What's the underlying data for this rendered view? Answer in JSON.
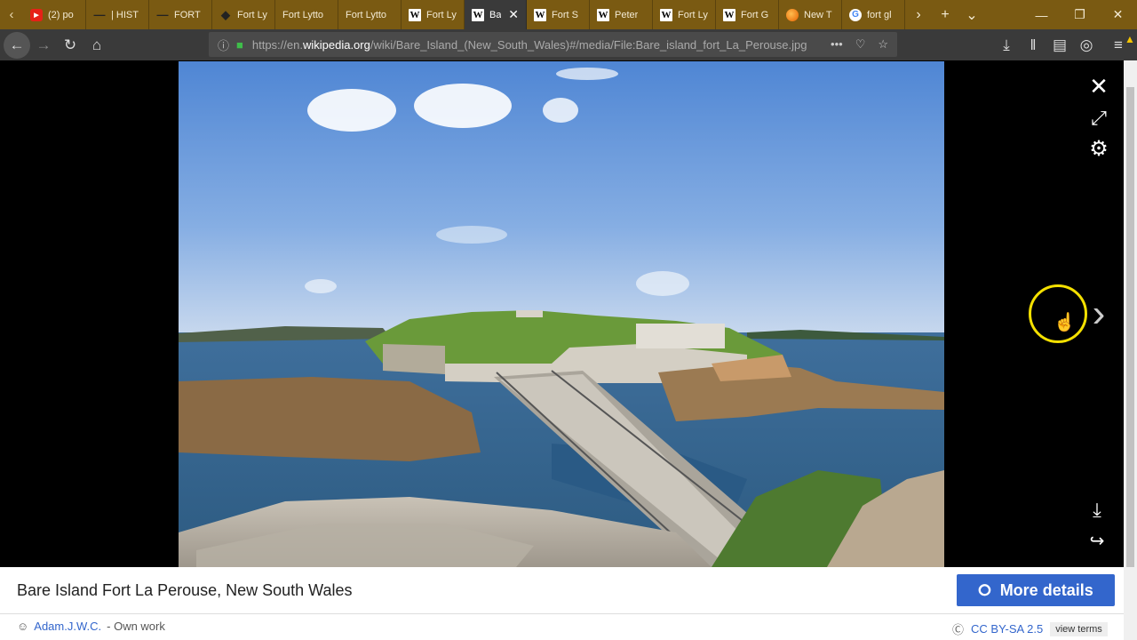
{
  "tabs": [
    {
      "title": "(2) po",
      "icon": "youtube-icon"
    },
    {
      "title": "| HIST",
      "icon": "bird-icon"
    },
    {
      "title": "FORT",
      "icon": "bird-icon"
    },
    {
      "title": "Fort Ly",
      "icon": "emblem-icon"
    },
    {
      "title": "Fort Lytto",
      "icon": "none"
    },
    {
      "title": "Fort Lytto",
      "icon": "none"
    },
    {
      "title": "Fort Ly",
      "icon": "wikipedia-icon"
    },
    {
      "title": "Ba",
      "icon": "wikipedia-icon",
      "active": true
    },
    {
      "title": "Fort S",
      "icon": "wikipedia-icon"
    },
    {
      "title": "Peter",
      "icon": "wikipedia-icon"
    },
    {
      "title": "Fort Ly",
      "icon": "wikipedia-icon"
    },
    {
      "title": "Fort G",
      "icon": "wikipedia-icon"
    },
    {
      "title": "New T",
      "icon": "firefox-icon"
    },
    {
      "title": "fort gl",
      "icon": "google-icon"
    }
  ],
  "url": {
    "prefix": "https://en.",
    "domain": "wikipedia.org",
    "path": "/wiki/Bare_Island_(New_South_Wales)#/media/File:Bare_island_fort_La_Perouse.jpg"
  },
  "caption": {
    "title": "Bare Island Fort La Perouse, New South Wales",
    "more_details": "More details",
    "author": "Adam.J.W.C.",
    "author_suffix": "- Own work",
    "license": "CC BY-SA 2.5",
    "view_terms": "view terms"
  },
  "colors": {
    "tabstrip": "#7a5a12",
    "toolbar": "#3a3a3a",
    "accent": "#3366cc",
    "cursor_ring": "#f4e000"
  }
}
